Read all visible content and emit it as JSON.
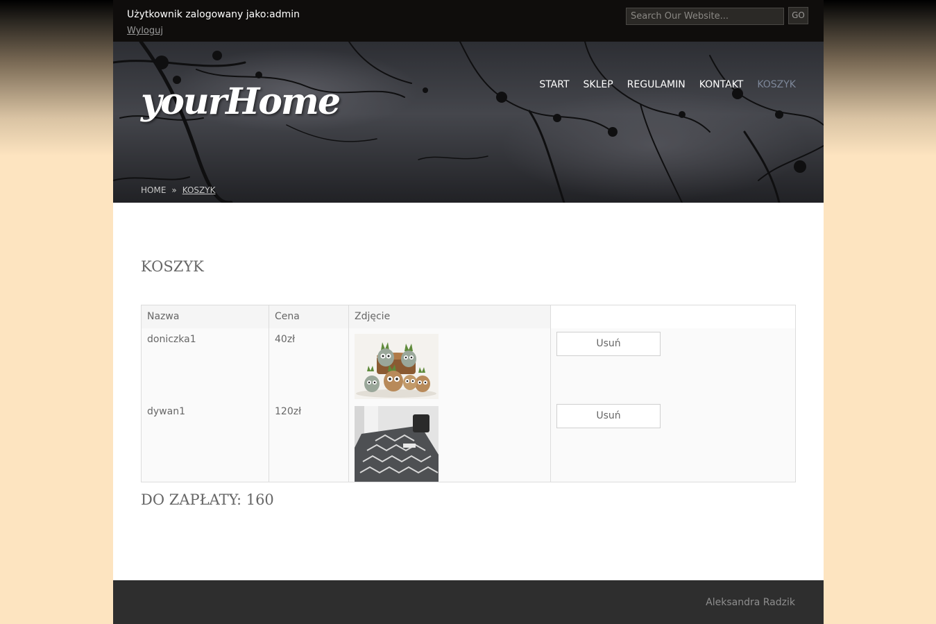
{
  "topbar": {
    "logged_in_text": "Użytkownik zalogowany jako:admin",
    "logout_label": "Wyloguj",
    "search_placeholder": "Search Our Website...",
    "go_label": "GO"
  },
  "header": {
    "logo": "yourHome",
    "nav": [
      {
        "label": "START",
        "active": false
      },
      {
        "label": "SKLEP",
        "active": false
      },
      {
        "label": "REGULAMIN",
        "active": false
      },
      {
        "label": "KONTAKT",
        "active": false
      },
      {
        "label": "KOSZYK",
        "active": true
      }
    ],
    "breadcrumb": {
      "home": "HOME",
      "separator": "»",
      "current": "KOSZYK"
    }
  },
  "main": {
    "title": "KOSZYK",
    "table": {
      "headers": [
        "Nazwa",
        "Cena",
        "Zdjęcie",
        ""
      ],
      "rows": [
        {
          "name": "doniczka1",
          "price": "40zł",
          "remove_label": "Usuń"
        },
        {
          "name": "dywan1",
          "price": "120zł",
          "remove_label": "Usuń"
        }
      ]
    },
    "total": "DO ZAPŁATY: 160"
  },
  "footer": {
    "author": "Aleksandra Radzik"
  },
  "colors": {
    "active_nav": "#7d8799",
    "footer_bg": "#2e2e2e",
    "page_bg": "#fde4c0"
  }
}
